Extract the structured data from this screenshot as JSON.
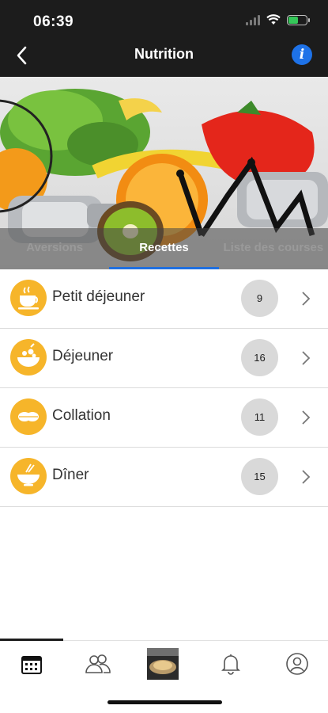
{
  "status_bar": {
    "time": "06:39"
  },
  "header": {
    "title": "Nutrition",
    "info_label": "i"
  },
  "tabs": [
    {
      "label": "Aversions",
      "active": false
    },
    {
      "label": "Recettes",
      "active": true
    },
    {
      "label": "Liste des courses",
      "active": false
    }
  ],
  "categories": [
    {
      "label": "Petit déjeuner",
      "count": "9",
      "icon": "coffee-cup-icon"
    },
    {
      "label": "Déjeuner",
      "count": "16",
      "icon": "salad-bowl-icon"
    },
    {
      "label": "Collation",
      "count": "11",
      "icon": "snack-icon"
    },
    {
      "label": "Dîner",
      "count": "15",
      "icon": "dinner-bowl-icon"
    }
  ],
  "bottom_nav": [
    {
      "icon": "calendar-icon",
      "active": true
    },
    {
      "icon": "community-icon",
      "active": false
    },
    {
      "icon": "food-photo-icon",
      "active": false
    },
    {
      "icon": "bell-icon",
      "active": false
    },
    {
      "icon": "profile-icon",
      "active": false
    }
  ],
  "colors": {
    "accent": "#f6b52a",
    "tab_indicator": "#1f6fe0",
    "info_button": "#1e72e8",
    "header_bg": "#1c1c1c"
  }
}
